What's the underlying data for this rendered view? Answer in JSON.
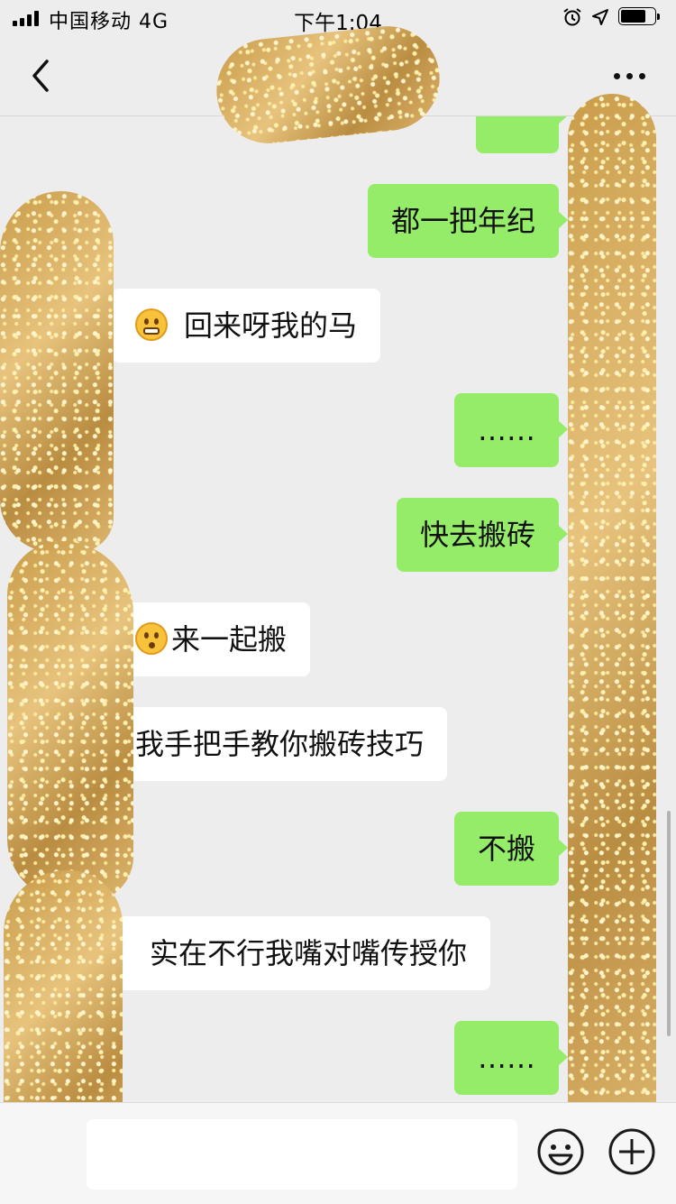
{
  "status_bar": {
    "carrier": "中国移动 4G",
    "time": "下午1:04",
    "battery_level": 0.75
  },
  "nav": {
    "back_icon": "chevron-left-icon",
    "more_icon": "ellipsis-icon"
  },
  "messages": [
    {
      "side": "out",
      "text": "都一把年纪"
    },
    {
      "side": "in",
      "text": "回来呀我的马",
      "emoji": "grin-emoji"
    },
    {
      "side": "out",
      "text": "……"
    },
    {
      "side": "out",
      "text": "快去搬砖"
    },
    {
      "side": "in",
      "text": "来一起搬",
      "emoji": "kiss-emoji"
    },
    {
      "side": "in",
      "text": "我手把手教你搬砖技巧"
    },
    {
      "side": "out",
      "text": "不搬"
    },
    {
      "side": "in",
      "text": "实在不行我嘴对嘴传授你"
    },
    {
      "side": "out",
      "text": "……"
    }
  ],
  "input": {
    "value": "",
    "emoji_icon": "smiley-icon",
    "plus_icon": "plus-circle-icon"
  },
  "colors": {
    "background": "#ededed",
    "outgoing_bubble": "#95ec69",
    "incoming_bubble": "#ffffff"
  }
}
